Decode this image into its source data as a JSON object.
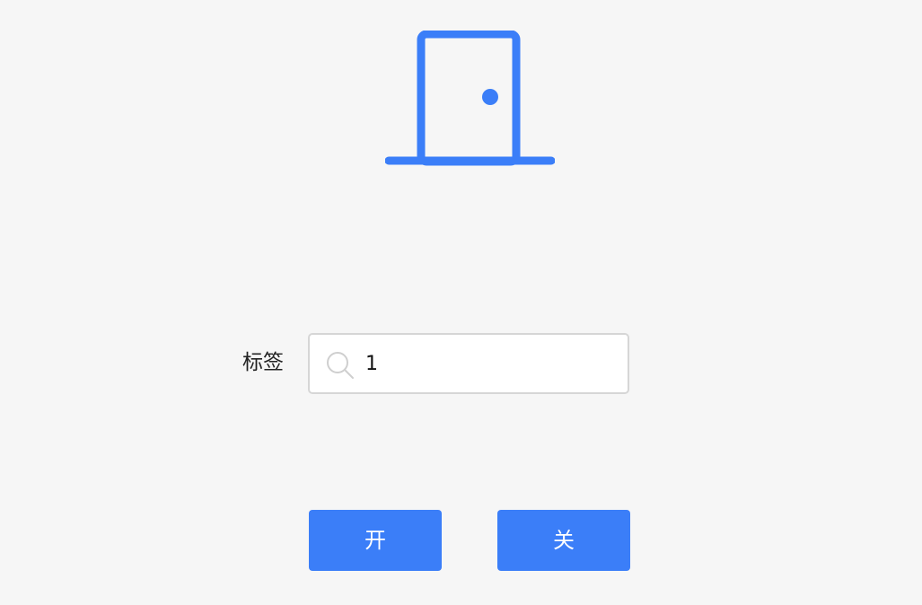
{
  "icons": {
    "door": "door-icon",
    "search": "search-icon"
  },
  "colors": {
    "accent": "#3b7ef8",
    "background": "#f6f6f6",
    "input_border": "#d6d6d6"
  },
  "form": {
    "label": "标签",
    "input_value": "1",
    "input_placeholder": ""
  },
  "actions": {
    "open_label": "开",
    "close_label": "关"
  }
}
